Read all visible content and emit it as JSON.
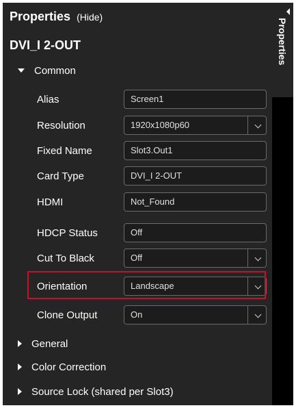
{
  "header": {
    "title": "Properties",
    "hide_label": "(Hide)"
  },
  "side_tab": {
    "label": "Properties"
  },
  "device": {
    "name": "DVI_I 2-OUT"
  },
  "sections": {
    "common": "Common",
    "general": "General",
    "color_correction": "Color Correction",
    "source_lock": "Source Lock (shared per Slot3)"
  },
  "properties": [
    {
      "label": "Alias",
      "value": "Screen1",
      "type": "text"
    },
    {
      "label": "Resolution",
      "value": "1920x1080p60",
      "type": "select"
    },
    {
      "label": "Fixed Name",
      "value": "Slot3.Out1",
      "type": "text"
    },
    {
      "label": "Card Type",
      "value": "DVI_I 2-OUT",
      "type": "text"
    },
    {
      "label": "HDMI",
      "value": "Not_Found",
      "type": "text"
    },
    {
      "label": "HDCP Status",
      "value": "Off",
      "type": "text"
    },
    {
      "label": "Cut To Black",
      "value": "Off",
      "type": "select"
    },
    {
      "label": "Orientation",
      "value": "Landscape",
      "type": "select",
      "highlighted": true
    },
    {
      "label": "Clone Output",
      "value": "On",
      "type": "select"
    }
  ],
  "colors": {
    "panel_bg": "#252525",
    "field_border": "#6a6a6a",
    "highlight": "#c8102e"
  }
}
